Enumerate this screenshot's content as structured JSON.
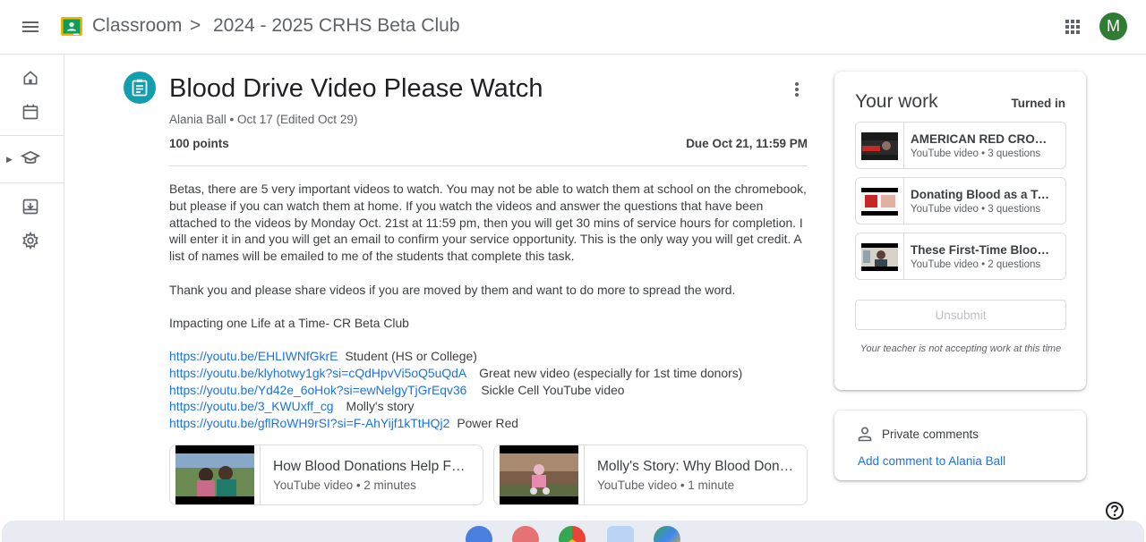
{
  "header": {
    "app_title": "Classroom",
    "separator": ">",
    "class_title": "2024 - 2025 CRHS Beta Club",
    "avatar_letter": "M",
    "avatar_color": "#2e7d32"
  },
  "assignment": {
    "title": "Blood Drive Video Please Watch",
    "meta": "Alania Ball • Oct 17 (Edited Oct 29)",
    "points": "100 points",
    "due": "Due Oct 21, 11:59 PM",
    "icon_color": "#129eaf",
    "description": [
      "Betas, there are 5 very important videos to watch. You may not be able to watch them at school on the chromebook, but please if you can watch them at home. If you watch the videos and answer the questions that have been attached to the videos by Monday Oct. 21st at 11:59 pm, then you will get 30 mins of service hours for completion. I will enter it in and you will get an email to confirm your service opportunity. This is the only way you will get credit. A list of names will be emailed to me of the students that complete this task.",
      "Thank you and please share videos if you are moved by them and want to do more to spread the word.",
      "Impacting one Life at a Time- CR Beta Club"
    ],
    "links": [
      {
        "url": "https://youtu.be/EHLIWNfGkrE",
        "label": "Student (HS or College)"
      },
      {
        "url": "https://youtu.be/klyhotwy1gk?si=cQdHpvVi5oQ5uQdA",
        "label": "Great new video (especially for 1st time donors)"
      },
      {
        "url": "https://youtu.be/Yd42e_6oHok?si=ewNelgyTjGrEqv36",
        "label": "Sickle Cell YouTube video"
      },
      {
        "url": "https://youtu.be/3_KWUxff_cg",
        "label": "Molly's story"
      },
      {
        "url": "https://youtu.be/gflRoWH9rSI?si=F-AhYijf1kTtHQj2",
        "label": "Power Red"
      }
    ],
    "attachments": [
      {
        "title": "How Blood Donations Help Families",
        "subtitle": "YouTube video • 2 minutes"
      },
      {
        "title": "Molly's Story: Why Blood Donation Matters",
        "subtitle": "YouTube video • 1 minute"
      }
    ]
  },
  "your_work": {
    "title": "Your work",
    "status": "Turned in",
    "items": [
      {
        "title": "AMERICAN RED CROSS - RESCUE",
        "subtitle": "YouTube video • 3 questions"
      },
      {
        "title": "Donating Blood as a Teen",
        "subtitle": "YouTube video • 3 questions"
      },
      {
        "title": "These First-Time Blood Donors",
        "subtitle": "YouTube video • 2 questions"
      }
    ],
    "unsubmit_label": "Unsubmit",
    "note": "Your teacher is not accepting work at this time"
  },
  "private_comments": {
    "title": "Private comments",
    "add_label": "Add comment to Alania Ball"
  },
  "colors": {
    "link": "#1a73e8",
    "classroom_green": "#0f9d58",
    "classroom_yellow": "#f4b400"
  }
}
